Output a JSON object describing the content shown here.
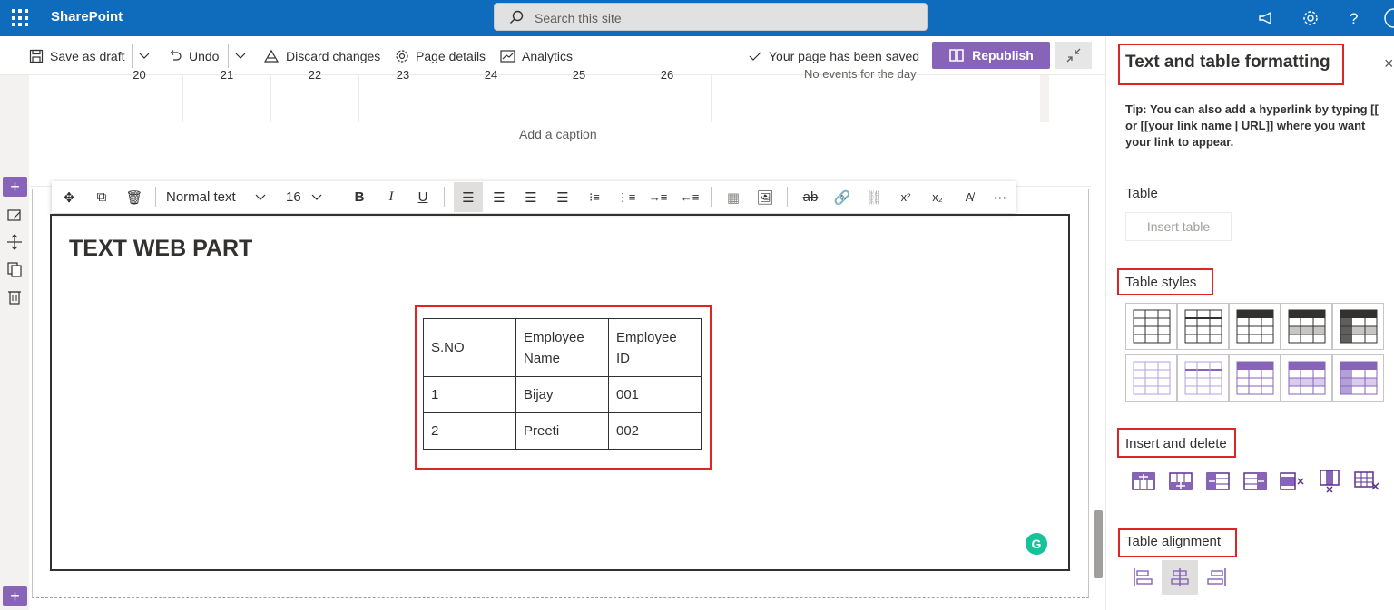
{
  "suite": {
    "app_name": "SharePoint",
    "search_placeholder": "Search this site"
  },
  "command_bar": {
    "save_draft": "Save as draft",
    "undo": "Undo",
    "discard": "Discard changes",
    "page_details": "Page details",
    "analytics": "Analytics",
    "saved_status": "Your page has been saved",
    "republish": "Republish"
  },
  "calendar_row": {
    "days": [
      "20",
      "21",
      "22",
      "23",
      "24",
      "25",
      "26"
    ],
    "no_events": "No events for the day"
  },
  "canvas": {
    "caption_placeholder": "Add a caption"
  },
  "toolbar": {
    "text_style": "Normal text",
    "font_size": "16"
  },
  "text_web_part": {
    "title": "TEXT WEB PART",
    "table": {
      "headers": [
        [
          "Employee",
          "S.NO"
        ],
        [
          "Employee",
          "Name"
        ],
        [
          "Employee",
          "ID"
        ]
      ],
      "rows": [
        [
          "1",
          "Bijay",
          "001"
        ],
        [
          "2",
          "Preeti",
          "002"
        ]
      ]
    }
  },
  "panel": {
    "title": "Text and table formatting",
    "tip": "Tip: You can also add a hyperlink by typing [[ or [[your link name | URL]] where you want your link to appear.",
    "table_heading": "Table",
    "insert_table": "Insert table",
    "table_styles_heading": "Table styles",
    "insert_delete_heading": "Insert and delete",
    "table_alignment_heading": "Table alignment"
  },
  "colors": {
    "suite_bar": "#0f6cbd",
    "accent_purple": "#8764b8",
    "highlight_red": "#e02424",
    "grammarly_green": "#15c39a"
  },
  "icons": [
    "waffle-icon",
    "megaphone-icon",
    "gear-icon",
    "help-icon",
    "save-icon",
    "undo-icon",
    "discard-icon",
    "page-details-icon",
    "analytics-icon",
    "check-icon",
    "book-icon",
    "collapse-icon"
  ]
}
